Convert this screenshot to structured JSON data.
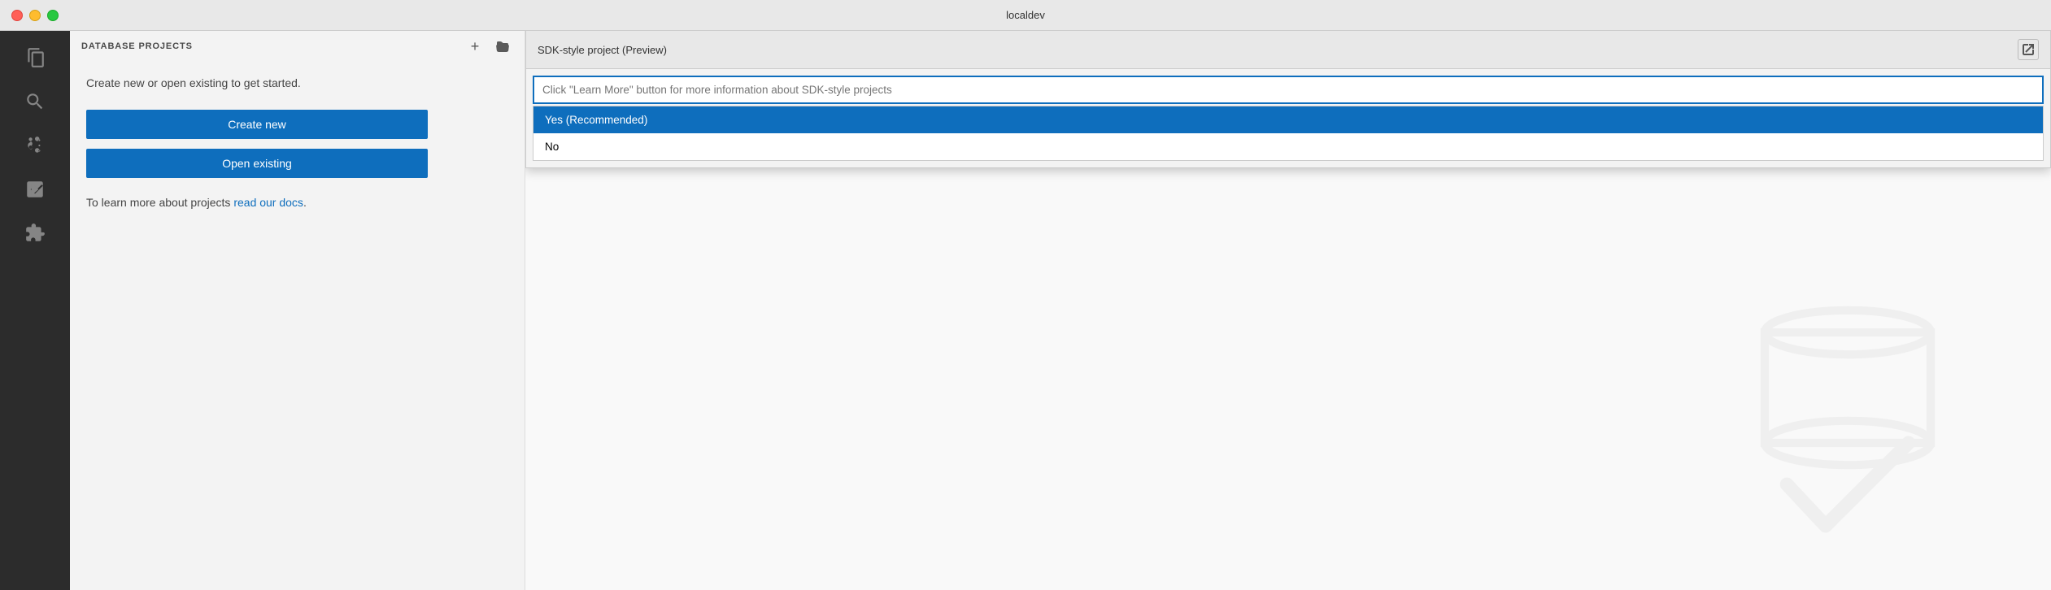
{
  "titlebar": {
    "title": "localdev"
  },
  "activity_bar": {
    "icons": [
      {
        "name": "explorer-icon",
        "label": "Explorer",
        "active": false
      },
      {
        "name": "search-icon",
        "label": "Search",
        "active": false
      },
      {
        "name": "source-control-icon",
        "label": "Source Control",
        "active": false
      },
      {
        "name": "run-debug-icon",
        "label": "Run and Debug",
        "active": false
      },
      {
        "name": "extensions-icon",
        "label": "Extensions",
        "active": false
      }
    ]
  },
  "side_panel": {
    "title": "DATABASE PROJECTS",
    "add_button_label": "+",
    "open_button_label": "⊡",
    "description": "Create new or open existing to get started.",
    "create_new_label": "Create new",
    "open_existing_label": "Open existing",
    "learn_more_prefix": "To learn more about projects ",
    "learn_more_link_text": "read our docs",
    "learn_more_suffix": "."
  },
  "dialog": {
    "title": "SDK-style project (Preview)",
    "input_placeholder": "Click \"Learn More\" button for more information about SDK-style projects",
    "options": [
      {
        "label": "Yes (Recommended)",
        "selected": true
      },
      {
        "label": "No",
        "selected": false
      }
    ],
    "external_icon": "⬡"
  }
}
